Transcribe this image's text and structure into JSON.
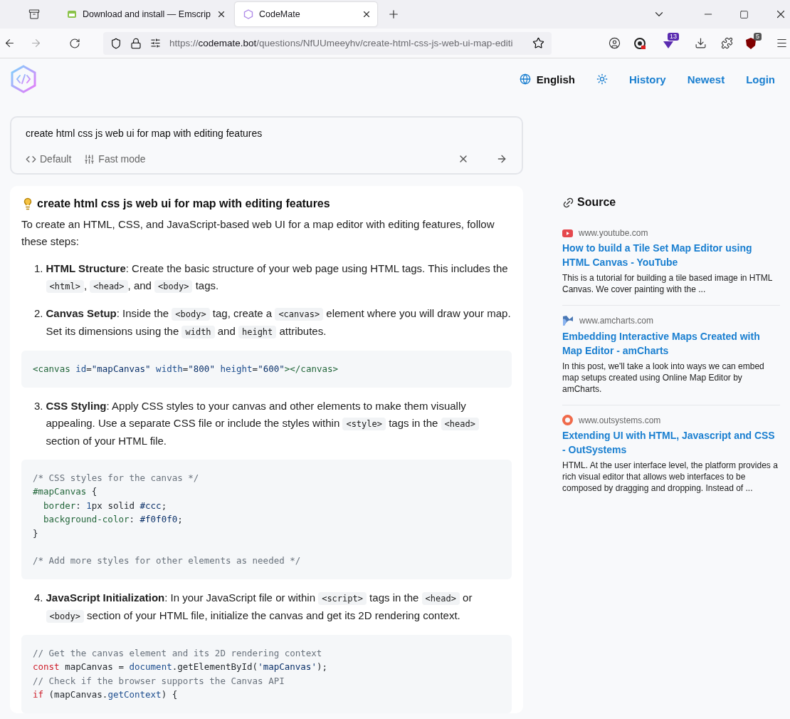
{
  "browser": {
    "tabs": [
      {
        "title": "Download and install — Emscrip",
        "kind": "emscripten",
        "selected": false
      },
      {
        "title": "CodeMate",
        "kind": "codemate",
        "selected": true
      }
    ],
    "url": {
      "scheme": "https://",
      "host": "codemate.bot",
      "path": "/questions/NfUUmeeyhv/create-html-css-js-web-ui-map-editi"
    },
    "badges": [
      "13",
      "5"
    ]
  },
  "header": {
    "language": "English",
    "links": [
      "History",
      "Newest",
      "Login"
    ]
  },
  "query": {
    "value": "create html css js web ui for map with editing features",
    "options": [
      "Default",
      "Fast mode"
    ]
  },
  "answer": {
    "title": "create html css js web ui for map with editing features",
    "intro": "To create an HTML, CSS, and JavaScript-based web UI for a map editor with editing features, follow these steps:",
    "items": [
      {
        "kind": "step",
        "number": "1.",
        "title": "HTML Structure",
        "parts": [
          {
            "kind": "text",
            "text": ": Create the basic structure of your web page using HTML tags. This includes the "
          },
          {
            "kind": "code",
            "text": "<html>"
          },
          {
            "kind": "text",
            "text": ", "
          },
          {
            "kind": "code",
            "text": "<head>"
          },
          {
            "kind": "text",
            "text": ", and "
          },
          {
            "kind": "code",
            "text": "<body>"
          },
          {
            "kind": "text",
            "text": " tags."
          }
        ]
      },
      {
        "kind": "step",
        "number": "2.",
        "title": "Canvas Setup",
        "parts": [
          {
            "kind": "text",
            "text": ": Inside the "
          },
          {
            "kind": "code",
            "text": "<body>"
          },
          {
            "kind": "text",
            "text": " tag, create a "
          },
          {
            "kind": "code",
            "text": "<canvas>"
          },
          {
            "kind": "text",
            "text": " element where you will draw your map. Set its dimensions using the "
          },
          {
            "kind": "code",
            "text": "width"
          },
          {
            "kind": "text",
            "text": " and "
          },
          {
            "kind": "code",
            "text": "height"
          },
          {
            "kind": "text",
            "text": " attributes."
          }
        ]
      },
      {
        "kind": "code",
        "sections": [
          [
            [
              {
                "kind": "tag",
                "text": "<canvas"
              },
              {
                "kind": "attr",
                "text": " id"
              },
              {
                "kind": "plain",
                "text": "="
              },
              {
                "kind": "string",
                "text": "\"mapCanvas\""
              },
              {
                "kind": "attr",
                "text": " width"
              },
              {
                "kind": "plain",
                "text": "="
              },
              {
                "kind": "string",
                "text": "\"800\""
              },
              {
                "kind": "attr",
                "text": " height"
              },
              {
                "kind": "plain",
                "text": "="
              },
              {
                "kind": "string",
                "text": "\"600\""
              },
              {
                "kind": "tag",
                "text": "></canvas>"
              }
            ]
          ]
        ]
      },
      {
        "kind": "step",
        "number": "3.",
        "title": "CSS Styling",
        "parts": [
          {
            "kind": "text",
            "text": ": Apply CSS styles to your canvas and other elements to make them visually appealing. Use a separate CSS file or include the styles within "
          },
          {
            "kind": "code",
            "text": "<style>"
          },
          {
            "kind": "text",
            "text": " tags in the "
          },
          {
            "kind": "code",
            "text": "<head>"
          },
          {
            "kind": "text",
            "text": " section of your HTML file."
          }
        ]
      },
      {
        "kind": "code",
        "sections": [
          [
            [
              {
                "kind": "comment",
                "text": "/* CSS styles for the canvas */"
              }
            ],
            [
              {
                "kind": "tag",
                "text": "#mapCanvas"
              },
              {
                "kind": "plain",
                "text": " {"
              }
            ],
            [
              {
                "kind": "tag",
                "text": "  border"
              },
              {
                "kind": "plain",
                "text": ": "
              },
              {
                "kind": "attr",
                "text": "1"
              },
              {
                "kind": "plain",
                "text": "px solid "
              },
              {
                "kind": "value",
                "text": "#ccc"
              },
              {
                "kind": "plain",
                "text": ";"
              }
            ],
            [
              {
                "kind": "tag",
                "text": "  background-color"
              },
              {
                "kind": "plain",
                "text": ": "
              },
              {
                "kind": "value",
                "text": "#f0f0f0"
              },
              {
                "kind": "plain",
                "text": ";"
              }
            ],
            [
              {
                "kind": "plain",
                "text": "}"
              }
            ]
          ],
          [
            [
              {
                "kind": "comment",
                "text": "/* Add more styles for other elements as needed */"
              }
            ]
          ]
        ]
      },
      {
        "kind": "step",
        "number": "4.",
        "title": "JavaScript Initialization",
        "parts": [
          {
            "kind": "text",
            "text": ": In your JavaScript file or within "
          },
          {
            "kind": "code",
            "text": "<script>"
          },
          {
            "kind": "text",
            "text": " tags in the "
          },
          {
            "kind": "code",
            "text": "<head>"
          },
          {
            "kind": "text",
            "text": " or "
          },
          {
            "kind": "code",
            "text": "<body>"
          },
          {
            "kind": "text",
            "text": " section of your HTML file, initialize the canvas and get its 2D rendering context."
          }
        ]
      },
      {
        "kind": "code",
        "sections": [
          [
            [
              {
                "kind": "comment",
                "text": "// Get the canvas element and its 2D rendering context"
              }
            ],
            [
              {
                "kind": "keyword",
                "text": "const"
              },
              {
                "kind": "plain",
                "text": " mapCanvas = "
              },
              {
                "kind": "attr",
                "text": "document"
              },
              {
                "kind": "plain",
                "text": ".getElementById("
              },
              {
                "kind": "string",
                "text": "'mapCanvas'"
              },
              {
                "kind": "plain",
                "text": ");"
              }
            ],
            [
              {
                "kind": "comment",
                "text": "// Check if the browser supports the Canvas API"
              }
            ],
            [
              {
                "kind": "keyword",
                "text": "if"
              },
              {
                "kind": "plain",
                "text": " (mapCanvas."
              },
              {
                "kind": "attr",
                "text": "getContext"
              },
              {
                "kind": "plain",
                "text": ") {"
              }
            ]
          ]
        ]
      }
    ]
  },
  "sources": {
    "title": "Source",
    "items": [
      {
        "kind": "youtube",
        "domain": "www.youtube.com",
        "title": "How to build a Tile Set Map Editor using HTML Canvas - YouTube",
        "snippet": "This is a tutorial for building a tile based image in HTML Canvas. We cover painting with the ..."
      },
      {
        "kind": "amcharts",
        "domain": "www.amcharts.com",
        "title": "Embedding Interactive Maps Created with Map Editor - amCharts",
        "snippet": "In this post, we'll take a look into ways we can embed map setups created using Online Map Editor by amCharts."
      },
      {
        "kind": "outsystems",
        "domain": "www.outsystems.com",
        "title": "Extending UI with HTML, Javascript and CSS - OutSystems",
        "snippet": "HTML. At the user interface level, the platform provides a rich visual editor that allows web interfaces to be composed by dragging and dropping. Instead of ..."
      }
    ]
  }
}
